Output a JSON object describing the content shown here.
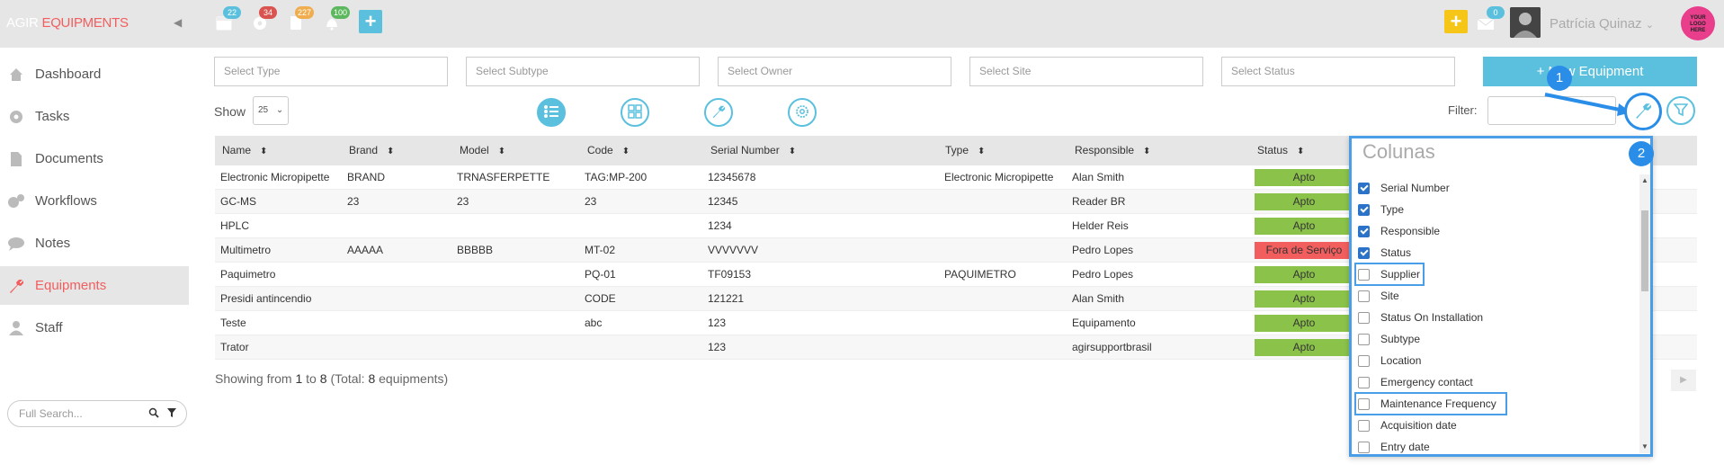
{
  "topbar": {
    "brand_1": "AGIR",
    "brand_2": "EQUIPMENTS",
    "collapse_icon": "caret-left-icon",
    "icons": [
      {
        "name": "calendar-icon",
        "badge": "22",
        "badge_color": "#5bc0de"
      },
      {
        "name": "gear-icon",
        "badge": "34",
        "badge_color": "#d9534f"
      },
      {
        "name": "clipboard-icon",
        "badge": "227",
        "badge_color": "#f0ad4e"
      },
      {
        "name": "bell-icon",
        "badge": "100",
        "badge_color": "#5cb85c"
      }
    ],
    "add_icon_color": "#5bc0de",
    "quick_add_color": "#f5c518",
    "mail_badge": "0",
    "user_name": "Patrícia Quinaz",
    "logo_text": "YOUR LOGO HERE"
  },
  "sidebar": {
    "items": [
      {
        "label": "Dashboard",
        "icon": "home-icon"
      },
      {
        "label": "Tasks",
        "icon": "gear-icon"
      },
      {
        "label": "Documents",
        "icon": "document-icon"
      },
      {
        "label": "Workflows",
        "icon": "gears-icon"
      },
      {
        "label": "Notes",
        "icon": "chat-icon"
      },
      {
        "label": "Equipments",
        "icon": "wrench-icon",
        "active": true
      },
      {
        "label": "Staff",
        "icon": "user-icon"
      }
    ],
    "search_placeholder": "Full Search..."
  },
  "filters": {
    "type": "Select Type",
    "subtype": "Select Subtype",
    "owner": "Select Owner",
    "site": "Select Site",
    "status": "Select Status",
    "new_button": "+ New Equipment"
  },
  "toolbar": {
    "show_label": "Show",
    "show_value": "25",
    "filter_label": "Filter:"
  },
  "table": {
    "headers": [
      "Name",
      "Brand",
      "Model",
      "Code",
      "Serial Number",
      "Type",
      "Responsible",
      "Status"
    ],
    "rows": [
      {
        "name": "Electronic Micropipette",
        "brand": "BRAND",
        "model": "TRNASFERPETTE",
        "code": "TAG:MP-200",
        "serial": "12345678",
        "type": "Electronic Micropipette",
        "responsible": "Alan Smith",
        "status": "Apto"
      },
      {
        "name": "GC-MS",
        "brand": "23",
        "model": "23",
        "code": "23",
        "serial": "12345",
        "type": "",
        "responsible": "Reader BR",
        "status": "Apto"
      },
      {
        "name": "HPLC",
        "brand": "",
        "model": "",
        "code": "",
        "serial": "1234",
        "type": "",
        "responsible": "Helder Reis",
        "status": "Apto"
      },
      {
        "name": "Multimetro",
        "brand": "AAAAA",
        "model": "BBBBB",
        "code": "MT-02",
        "serial": "VVVVVVV",
        "type": "",
        "responsible": "Pedro Lopes",
        "status": "Fora de Serviço"
      },
      {
        "name": "Paquimetro",
        "brand": "",
        "model": "",
        "code": "PQ-01",
        "serial": "TF09153",
        "type": "PAQUIMETRO",
        "responsible": "Pedro Lopes",
        "status": "Apto"
      },
      {
        "name": "Presidi antincendio",
        "brand": "",
        "model": "",
        "code": "CODE",
        "serial": "121221",
        "type": "",
        "responsible": "Alan Smith",
        "status": "Apto"
      },
      {
        "name": "Teste",
        "brand": "",
        "model": "",
        "code": "abc",
        "serial": "123",
        "type": "",
        "responsible": "Equipamento",
        "status": "Apto"
      },
      {
        "name": "Trator",
        "brand": "",
        "model": "",
        "code": "",
        "serial": "123",
        "type": "",
        "responsible": "agirsupportbrasil",
        "status": "Apto"
      }
    ],
    "status_colors": {
      "Apto": "#8bc34a",
      "Fora de Serviço": "#f25e5e"
    },
    "footer_prefix": "Showing from",
    "footer_from": "1",
    "footer_to_word": "to",
    "footer_to": "8",
    "footer_total_prefix": "(Total:",
    "footer_total": "8",
    "footer_total_suffix": "equipments)"
  },
  "columns_panel": {
    "title": "Colunas",
    "items": [
      {
        "label": "Serial Number",
        "checked": true
      },
      {
        "label": "Type",
        "checked": true
      },
      {
        "label": "Responsible",
        "checked": true
      },
      {
        "label": "Status",
        "checked": true
      },
      {
        "label": "Supplier",
        "checked": false,
        "highlighted": true
      },
      {
        "label": "Site",
        "checked": false
      },
      {
        "label": "Status On Installation",
        "checked": false
      },
      {
        "label": "Subtype",
        "checked": false
      },
      {
        "label": "Location",
        "checked": false
      },
      {
        "label": "Emergency contact",
        "checked": false
      },
      {
        "label": "Maintenance Frequency",
        "checked": false,
        "highlighted": true
      },
      {
        "label": "Acquisition date",
        "checked": false
      },
      {
        "label": "Entry date",
        "checked": false
      }
    ]
  },
  "callouts": {
    "one": "1",
    "two": "2"
  },
  "accent_color": "#5bc0de",
  "highlight_color": "#2a8ee8"
}
